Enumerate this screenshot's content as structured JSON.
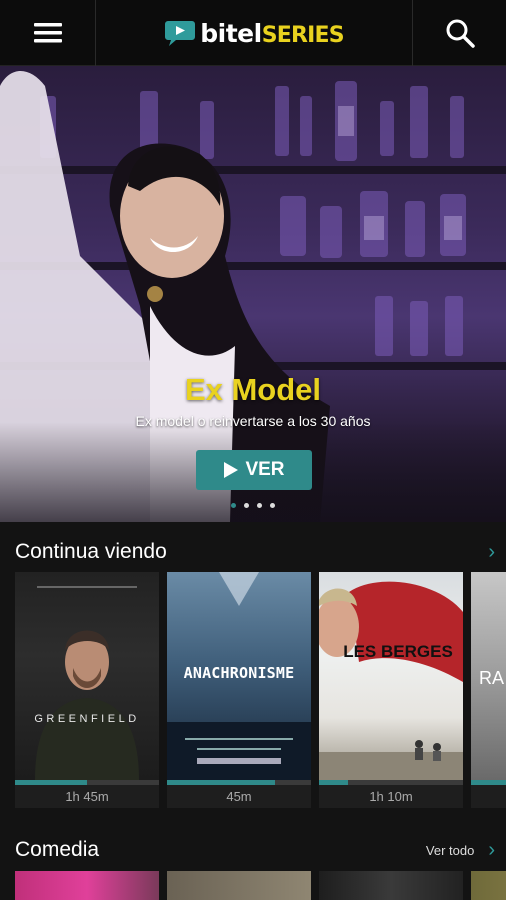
{
  "header": {
    "menu_icon": "hamburger-icon",
    "logo_word": "bitel",
    "logo_series": "SERIES",
    "search_icon": "search-icon"
  },
  "hero": {
    "title": "Ex Model",
    "subtitle": "Ex model o reinvertarse a los 30 años",
    "button_label": "VER",
    "slides": 4,
    "active_slide": 0
  },
  "continue_watching": {
    "title": "Continua viendo",
    "items": [
      {
        "poster_title": "GREENFIELD",
        "duration": "1h 45m",
        "progress": 0.5
      },
      {
        "poster_title": "ANACHRONISME",
        "duration": "45m",
        "progress": 0.75
      },
      {
        "poster_title": "LES BERGES",
        "duration": "1h 10m",
        "progress": 0.2
      },
      {
        "poster_title": "RA",
        "duration": "",
        "progress": 0.3
      }
    ]
  },
  "comedia": {
    "title": "Comedia",
    "see_all": "Ver todo"
  },
  "colors": {
    "accent": "#2f8a8a",
    "brand_yellow": "#e9d21f",
    "background": "#131313"
  }
}
